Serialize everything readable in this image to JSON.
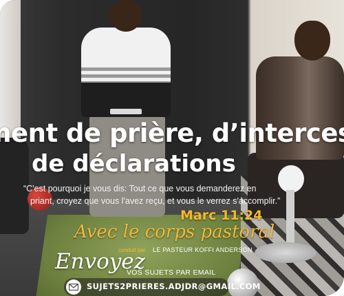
{
  "headline": {
    "line1": "ment de prière, d’intercessi",
    "line2": "de déclarations"
  },
  "quote": {
    "line1": "“C'est pourquoi je vous dis: Tout ce que vous demanderez en",
    "line2": "priant, croyez que vous l'avez reçu, et vous le verrez s'accomplir.”",
    "reference": "Marc 11:24"
  },
  "pastoral": {
    "script": "Avec le corps pastoral",
    "conduit_par": "conduit par",
    "pastor_name": "LE PASTEUR KOFFI ANDERSON"
  },
  "send": {
    "script": "Envoyez",
    "subjects": "VOS SUJETS PAR EMAIL",
    "email": "SUJETS2PRIERES.ADJDR@GMAIL.COM",
    "icon": "envelope-icon"
  },
  "colors": {
    "accent_gold": "#f0b93a",
    "reference_gold": "#f3b92c",
    "text_white": "#ffffff"
  }
}
